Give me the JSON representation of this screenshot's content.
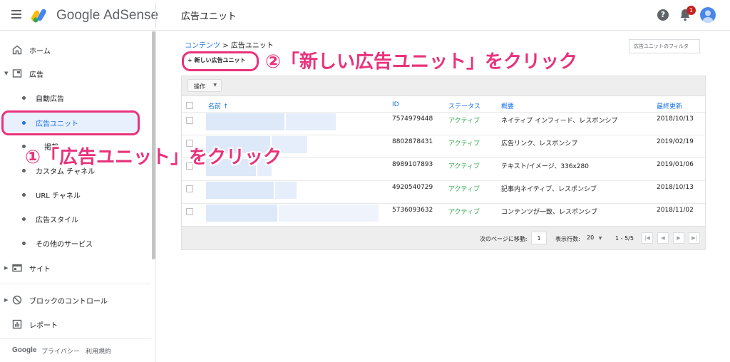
{
  "topbar": {
    "brand_google": "Google",
    "brand_product": "AdSense",
    "page_title": "広告ユニット",
    "help_glyph": "?",
    "notification_count": "1"
  },
  "sidebar": {
    "items": [
      {
        "label": "ホーム",
        "icon": "home-icon"
      },
      {
        "label": "広告",
        "icon": "ad-icon"
      },
      {
        "label": "自動広告"
      },
      {
        "label": "広告ユニット"
      },
      {
        "label": "掲載"
      },
      {
        "label": "カスタム チャネル"
      },
      {
        "label": "URL チャネル"
      },
      {
        "label": "広告スタイル"
      },
      {
        "label": "その他のサービス"
      },
      {
        "label": "サイト",
        "icon": "site-icon"
      },
      {
        "label": "ブロックのコントロール",
        "icon": "block-icon"
      },
      {
        "label": "レポート",
        "icon": "report-icon"
      }
    ],
    "footer": {
      "google": "Google",
      "privacy": "プライバシー",
      "terms": "利用規約"
    }
  },
  "annotations": {
    "step1": "①「広告ユニット」をクリック",
    "step2": "②「新しい広告ユニット」をクリック"
  },
  "main": {
    "breadcrumb_parent": "コンテンツ",
    "breadcrumb_sep": ">",
    "breadcrumb_current": "広告ユニット",
    "new_button": "+ 新しい広告ユニット",
    "filter_placeholder": "広告ユニットのフィルタ",
    "ops_button": "操作",
    "columns": {
      "name": "名前 ↑",
      "id": "ID",
      "status": "ステータス",
      "summary": "概要",
      "updated": "最終更新"
    },
    "rows": [
      {
        "id": "7574979448",
        "status": "アクティブ",
        "summary": "ネイティブ インフィード、レスポンシブ",
        "updated": "2018/10/13"
      },
      {
        "id": "8802878431",
        "status": "アクティブ",
        "summary": "広告リンク、レスポンシブ",
        "updated": "2019/02/19"
      },
      {
        "id": "8989107893",
        "status": "アクティブ",
        "summary": "テキスト/イメージ、336x280",
        "updated": "2019/01/06"
      },
      {
        "id": "4920540729",
        "status": "アクティブ",
        "summary": "記事内ネイティブ、レスポンシブ",
        "updated": "2018/10/13"
      },
      {
        "id": "5736093632",
        "status": "アクティブ",
        "summary": "コンテンツが一致、レスポンシブ",
        "updated": "2018/11/02"
      }
    ],
    "pager": {
      "next_page_label": "次のページに移動:",
      "page_value": "1",
      "rows_label": "表示行数:",
      "rows_value": "20",
      "range": "1 - 5/5"
    }
  },
  "colors": {
    "accent": "#1a73e8",
    "annotation": "#e8337c",
    "status_active": "#34a853"
  }
}
